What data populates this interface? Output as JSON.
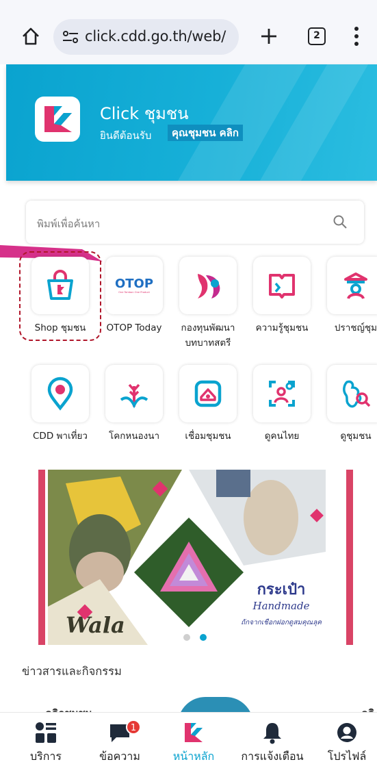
{
  "browser": {
    "url": "click.cdd.go.th/web/",
    "tab_count": "2"
  },
  "banner": {
    "app_name": "Click ชุมชน",
    "welcome": "ยินดีต้อนรับ",
    "user_name": "คุณชุมชน คลิก"
  },
  "search": {
    "placeholder": "พิมพ์เพื่อค้นหา"
  },
  "services": [
    {
      "label": "Shop ชุมชน",
      "icon": "shopping-bag-icon"
    },
    {
      "label": "OTOP Today",
      "icon": "otop-logo-icon",
      "logo_text": "OTOP",
      "logo_subtext": "One Tambon One Product"
    },
    {
      "label": "กองทุนพัฒนา บทบาทสตรี",
      "icon": "women-fund-logo-icon"
    },
    {
      "label": "ความรู้ชุมชน",
      "icon": "open-book-icon"
    },
    {
      "label": "ปราชญ์ชุม",
      "icon": "sage-person-icon"
    },
    {
      "label": "CDD พาเที่ยว",
      "icon": "map-pin-icon"
    },
    {
      "label": "โคกหนองนา",
      "icon": "rice-plant-icon"
    },
    {
      "label": "เชื่อมชุมชน",
      "icon": "home-connect-icon"
    },
    {
      "label": "ดูคนไทย",
      "icon": "person-search-icon"
    },
    {
      "label": "ดูชุมชน",
      "icon": "map-search-icon"
    }
  ],
  "carousel": {
    "slide_brand": "Wala",
    "slide_title": "กระเป๋า",
    "slide_subtitle": "Handmade",
    "slide_caption": "ถักจากเชือกฝอกดูสมคุณลุค",
    "active_index": 1,
    "slide_count": 2
  },
  "news": {
    "heading": "ข่าวสารและกิจกรรม",
    "peek_left": "คลิกชุมชน",
    "peek_right": "คลิ"
  },
  "bottom_nav": [
    {
      "label": "บริการ",
      "icon": "services-grid-icon"
    },
    {
      "label": "ข้อความ",
      "icon": "message-icon",
      "badge": "1"
    },
    {
      "label": "หน้าหลัก",
      "icon": "home-logo-icon",
      "active": true
    },
    {
      "label": "การแจ้งเตือน",
      "icon": "bell-icon"
    },
    {
      "label": "โปรไฟล์",
      "icon": "profile-icon"
    }
  ],
  "colors": {
    "brand_teal": "#0aa3cf",
    "brand_pink": "#e0336e",
    "annotation": "#b0162a"
  }
}
